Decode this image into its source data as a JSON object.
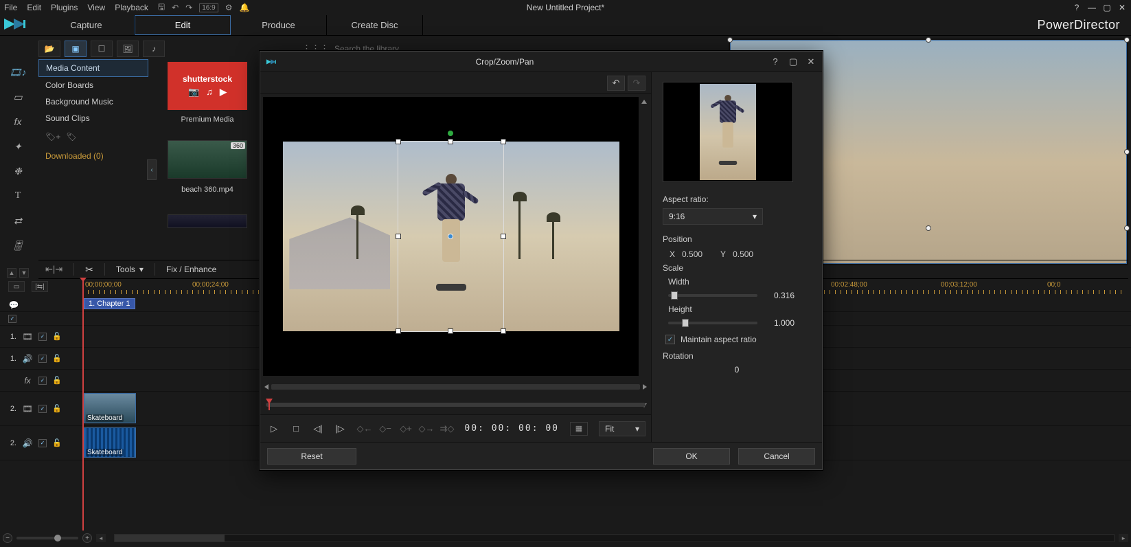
{
  "app": {
    "title": "New Untitled Project*",
    "brand": "PowerDirector"
  },
  "menubar": {
    "file": "File",
    "edit": "Edit",
    "plugins": "Plugins",
    "view": "View",
    "playback": "Playback",
    "aspect_badge": "16:9"
  },
  "tabs": {
    "capture": "Capture",
    "edit": "Edit",
    "produce": "Produce",
    "createdisc": "Create Disc"
  },
  "library": {
    "search_placeholder": "Search the library",
    "categories": {
      "media": "Media Content",
      "color": "Color Boards",
      "bgm": "Background Music",
      "sound": "Sound Clips"
    },
    "downloaded": "Downloaded  (0)",
    "shutterstock": "shutterstock",
    "premium": "Premium Media",
    "clip_beach": "beach 360.mp4",
    "badge_360": "360"
  },
  "toolsrow": {
    "tools": "Tools",
    "fix": "Fix / Enhance"
  },
  "timeline": {
    "ticks": [
      "00;00;00;00",
      "00;00;24;00",
      "00:02:48;00",
      "00;03;12;00",
      "00;0"
    ],
    "chapter": "1. Chapter 1",
    "clip_label": "Skateboard",
    "tracks": [
      {
        "num": "1.",
        "kind": "video"
      },
      {
        "num": "1.",
        "kind": "audio"
      },
      {
        "num": "",
        "kind": "fx"
      },
      {
        "num": "2.",
        "kind": "video"
      },
      {
        "num": "2.",
        "kind": "audio"
      }
    ]
  },
  "dialog": {
    "title": "Crop/Zoom/Pan",
    "aspect_label": "Aspect ratio:",
    "aspect_value": "9:16",
    "position_label": "Position",
    "pos_x_label": "X",
    "pos_x": "0.500",
    "pos_y_label": "Y",
    "pos_y": "0.500",
    "scale_label": "Scale",
    "width_label": "Width",
    "width_val": "0.316",
    "height_label": "Height",
    "height_val": "1.000",
    "maintain": "Maintain aspect ratio",
    "rotation_label": "Rotation",
    "rotation_val": "0",
    "timecode": "00: 00: 00: 00",
    "fit": "Fit",
    "reset": "Reset",
    "ok": "OK",
    "cancel": "Cancel"
  }
}
